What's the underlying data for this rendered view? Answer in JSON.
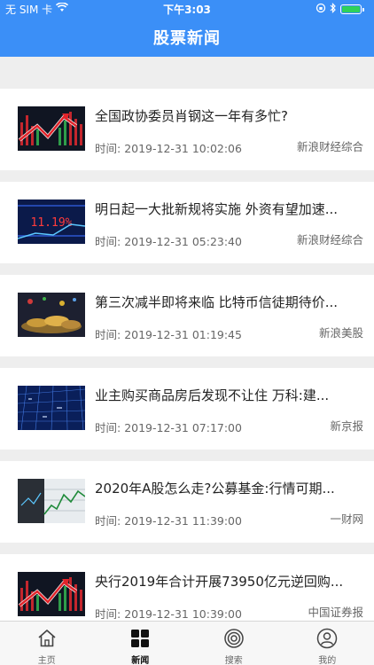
{
  "status_bar": {
    "carrier": "无 SIM 卡",
    "time": "下午3:03"
  },
  "header": {
    "title": "股票新闻"
  },
  "news": [
    {
      "headline": "全国政协委员肖钢这一年有多忙?",
      "time_label": "时间:",
      "datetime": "2019-12-31 10:02:06",
      "source": "新浪财经综合",
      "thumb": "chart-red-arrow"
    },
    {
      "headline": "明日起一大批新规将实施 外资有望加速...",
      "time_label": "时间:",
      "datetime": "2019-12-31 05:23:40",
      "source": "新浪财经综合",
      "thumb": "chart-red-arrow"
    },
    {
      "headline": "第三次减半即将来临 比特币信徒期待价...",
      "time_label": "时间:",
      "datetime": "2019-12-31 01:19:45",
      "source": "新浪美股",
      "thumb": "chart-blue"
    },
    {
      "headline": "业主购买商品房后发现不让住 万科:建...",
      "time_label": "时间:",
      "datetime": "2019-12-31 07:17:00",
      "source": "新京报",
      "thumb": "coins"
    },
    {
      "headline": "2020年A股怎么走?公募基金:行情可期...",
      "time_label": "时间:",
      "datetime": "2019-12-31 11:39:00",
      "source": "一财网",
      "thumb": "grid-blue"
    },
    {
      "headline": "央行2019年合计开展73950亿元逆回购...",
      "time_label": "时间:",
      "datetime": "2019-12-31 10:39:00",
      "source": "中国证券报",
      "thumb": "chart-red-arrow"
    }
  ],
  "tabbar": {
    "items": [
      {
        "label": "主页",
        "icon": "home-icon"
      },
      {
        "label": "新闻",
        "icon": "grid-icon",
        "active": true
      },
      {
        "label": "搜索",
        "icon": "target-icon"
      },
      {
        "label": "我的",
        "icon": "user-icon"
      }
    ]
  },
  "colors": {
    "header": "#3b8ff7",
    "accent_red": "#d8262c"
  }
}
